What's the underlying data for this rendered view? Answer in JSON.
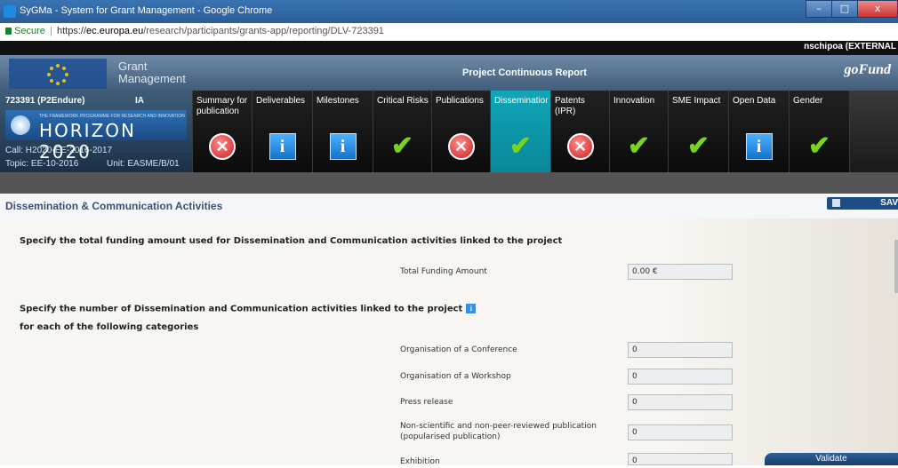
{
  "window": {
    "title": "SyGMa - System for Grant Management - Google Chrome",
    "minimize": "–",
    "maximize": "□",
    "close": "x"
  },
  "address": {
    "secure_label": "Secure",
    "separator": "|",
    "url_scheme": "https://",
    "url_host": "ec.europa.eu",
    "url_path": "/research/participants/grants-app/reporting/DLV-723391"
  },
  "user": {
    "name": "nschipoa (EXTERNAL"
  },
  "banner": {
    "grant_line1": "Grant",
    "grant_line2": "Management",
    "report_title": "Project Continuous Report",
    "logo_text": "goFund"
  },
  "project": {
    "id": "723391 (P2Endure)",
    "type": "IA",
    "programme_small": "THE FRAMEWORK PROGRAMME FOR RESEARCH AND INNOVATION",
    "programme_big": "HORIZON 2020",
    "call": "Call: H2020-EE-2016-2017",
    "topic": "Topic: EE-10-2016",
    "unit": "Unit: EASME/B/01"
  },
  "tabs": [
    {
      "label": "Summary for publication",
      "status": "cross",
      "symbol": "✕"
    },
    {
      "label": "Deliverables",
      "status": "info",
      "symbol": "i"
    },
    {
      "label": "Milestones",
      "status": "info",
      "symbol": "i"
    },
    {
      "label": "Critical Risks",
      "status": "check",
      "symbol": "✔"
    },
    {
      "label": "Publications",
      "status": "cross",
      "symbol": "✕"
    },
    {
      "label": "Disseminatior",
      "status": "check",
      "symbol": "✔",
      "active": true
    },
    {
      "label": "Patents (IPR)",
      "status": "cross",
      "symbol": "✕"
    },
    {
      "label": "Innovation",
      "status": "check",
      "symbol": "✔"
    },
    {
      "label": "SME Impact",
      "status": "check",
      "symbol": "✔"
    },
    {
      "label": "Open Data",
      "status": "info",
      "symbol": "i"
    },
    {
      "label": "Gender",
      "status": "check",
      "symbol": "✔"
    }
  ],
  "section": {
    "title": "Dissemination & Communication Activities",
    "save_label": "SAV"
  },
  "form": {
    "q1": "Specify the total funding amount used for Dissemination and Communication activities linked to the project",
    "total_funding_label": "Total Funding Amount",
    "total_funding_value": "0.00 €",
    "q2": "Specify the number of Dissemination and Communication activities linked to the project",
    "q2_info": "i",
    "q2_sub": "for each of the following categories",
    "fields": [
      {
        "label": "Organisation of a Conference",
        "value": "0"
      },
      {
        "label": "Organisation of a Workshop",
        "value": "0"
      },
      {
        "label": "Press release",
        "value": "0"
      },
      {
        "label": "Non-scientific and non-peer-reviewed publication (popularised publication)",
        "value": "0"
      },
      {
        "label": "Exhibition",
        "value": "0"
      }
    ]
  },
  "validate_label": "Validate",
  "colors": {
    "active_tab": "#0fa6b8",
    "check": "#78d31c",
    "cross": "#cc1f1f",
    "info": "#1472c9",
    "heading": "#3c4f73"
  }
}
